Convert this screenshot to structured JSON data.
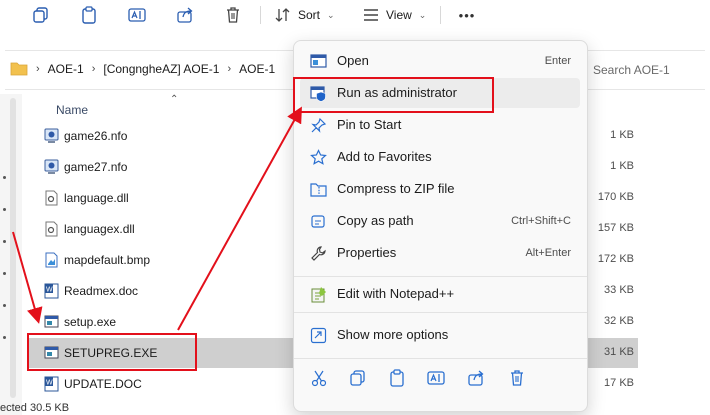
{
  "toolbar": {
    "sort_label": "Sort",
    "view_label": "View",
    "more_label": "•••"
  },
  "address": {
    "crumbs": [
      "AOE-1",
      "[CongngheAZ] AOE-1",
      "AOE-1"
    ],
    "search_placeholder": "Search AOE-1"
  },
  "file_list": {
    "name_header": "Name",
    "rows": [
      {
        "name": "game26.nfo",
        "size": "1 KB",
        "icon": "nfo-icon"
      },
      {
        "name": "game27.nfo",
        "size": "1 KB",
        "icon": "nfo-icon"
      },
      {
        "name": "language.dll",
        "size": "170 KB",
        "icon": "dll-icon"
      },
      {
        "name": "languagex.dll",
        "size": "157 KB",
        "icon": "dll-icon"
      },
      {
        "name": "mapdefault.bmp",
        "size": "172 KB",
        "icon": "bmp-icon"
      },
      {
        "name": "Readmex.doc",
        "size": "33 KB",
        "icon": "word-doc-icon"
      },
      {
        "name": "setup.exe",
        "size": "32 KB",
        "icon": "exe-icon"
      },
      {
        "name": "SETUPREG.EXE",
        "size": "31 KB",
        "icon": "exe-icon"
      },
      {
        "name": "UPDATE.DOC",
        "size": "17 KB",
        "icon": "word-doc-icon"
      }
    ]
  },
  "statusbar": {
    "text": "ected  30.5 KB"
  },
  "context_menu": {
    "items": [
      {
        "label": "Open",
        "shortcut": "Enter",
        "icon": "open-app-icon"
      },
      {
        "label": "Run as administrator",
        "shortcut": "",
        "icon": "shield-admin-icon"
      },
      {
        "label": "Pin to Start",
        "shortcut": "",
        "icon": "pin-icon"
      },
      {
        "label": "Add to Favorites",
        "shortcut": "",
        "icon": "star-icon"
      },
      {
        "label": "Compress to ZIP file",
        "shortcut": "",
        "icon": "zip-folder-icon"
      },
      {
        "label": "Copy as path",
        "shortcut": "Ctrl+Shift+C",
        "icon": "copy-path-icon"
      },
      {
        "label": "Properties",
        "shortcut": "Alt+Enter",
        "icon": "wrench-icon"
      },
      {
        "label": "Edit with Notepad++",
        "shortcut": "",
        "icon": "notepadpp-icon"
      },
      {
        "label": "Show more options",
        "shortcut": "",
        "icon": "show-more-icon"
      }
    ],
    "bottom_icons": [
      "cut-icon",
      "copy-icon",
      "paste-icon",
      "rename-icon",
      "share-icon",
      "delete-icon"
    ]
  },
  "colors": {
    "annotation_red": "#e3101b",
    "selection": "#cfcfcf",
    "accent_blue": "#1f4e9c"
  }
}
